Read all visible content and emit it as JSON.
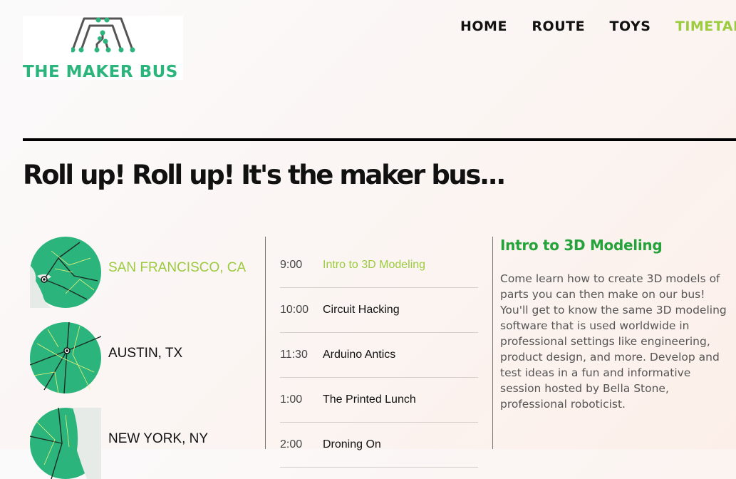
{
  "brand": {
    "name": "THE MAKER BUS",
    "color": "#2bb57d",
    "logo_icon": "circuit-bus-icon"
  },
  "nav": {
    "items": [
      {
        "label": "HOME",
        "active": false
      },
      {
        "label": "ROUTE",
        "active": false
      },
      {
        "label": "TOYS",
        "active": false
      },
      {
        "label": "TIMETABLE",
        "active": true
      }
    ],
    "active_color": "#9ccb3f"
  },
  "headline": "Roll up! Roll up! It's the maker bus...",
  "cities": [
    {
      "name": "SAN FRANCISCO, CA",
      "active": true,
      "map_icon": "san-francisco-map-icon"
    },
    {
      "name": "AUSTIN, TX",
      "active": false,
      "map_icon": "austin-map-icon"
    },
    {
      "name": "NEW YORK, NY",
      "active": false,
      "map_icon": "new-york-map-icon"
    }
  ],
  "schedule": [
    {
      "time": "9:00",
      "title": "Intro to 3D Modeling",
      "active": true
    },
    {
      "time": "10:00",
      "title": "Circuit Hacking",
      "active": false
    },
    {
      "time": "11:30",
      "title": "Arduino Antics",
      "active": false
    },
    {
      "time": "1:00",
      "title": "The Printed Lunch",
      "active": false
    },
    {
      "time": "2:00",
      "title": "Droning On",
      "active": false
    }
  ],
  "detail": {
    "title": "Intro to 3D Modeling",
    "title_color": "#25a23a",
    "body": "Come learn how to create 3D models of parts you can then make on our bus! You'll get to know the same 3D modeling software that is used worldwide in professional settings like engineering, product design, and more. Develop and test ideas in a fun and informative session hosted by Bella Stone, professional roboticist."
  },
  "colors": {
    "map_green": "#2bb57d",
    "accent": "#9ccb3f",
    "rule": "#000000"
  }
}
